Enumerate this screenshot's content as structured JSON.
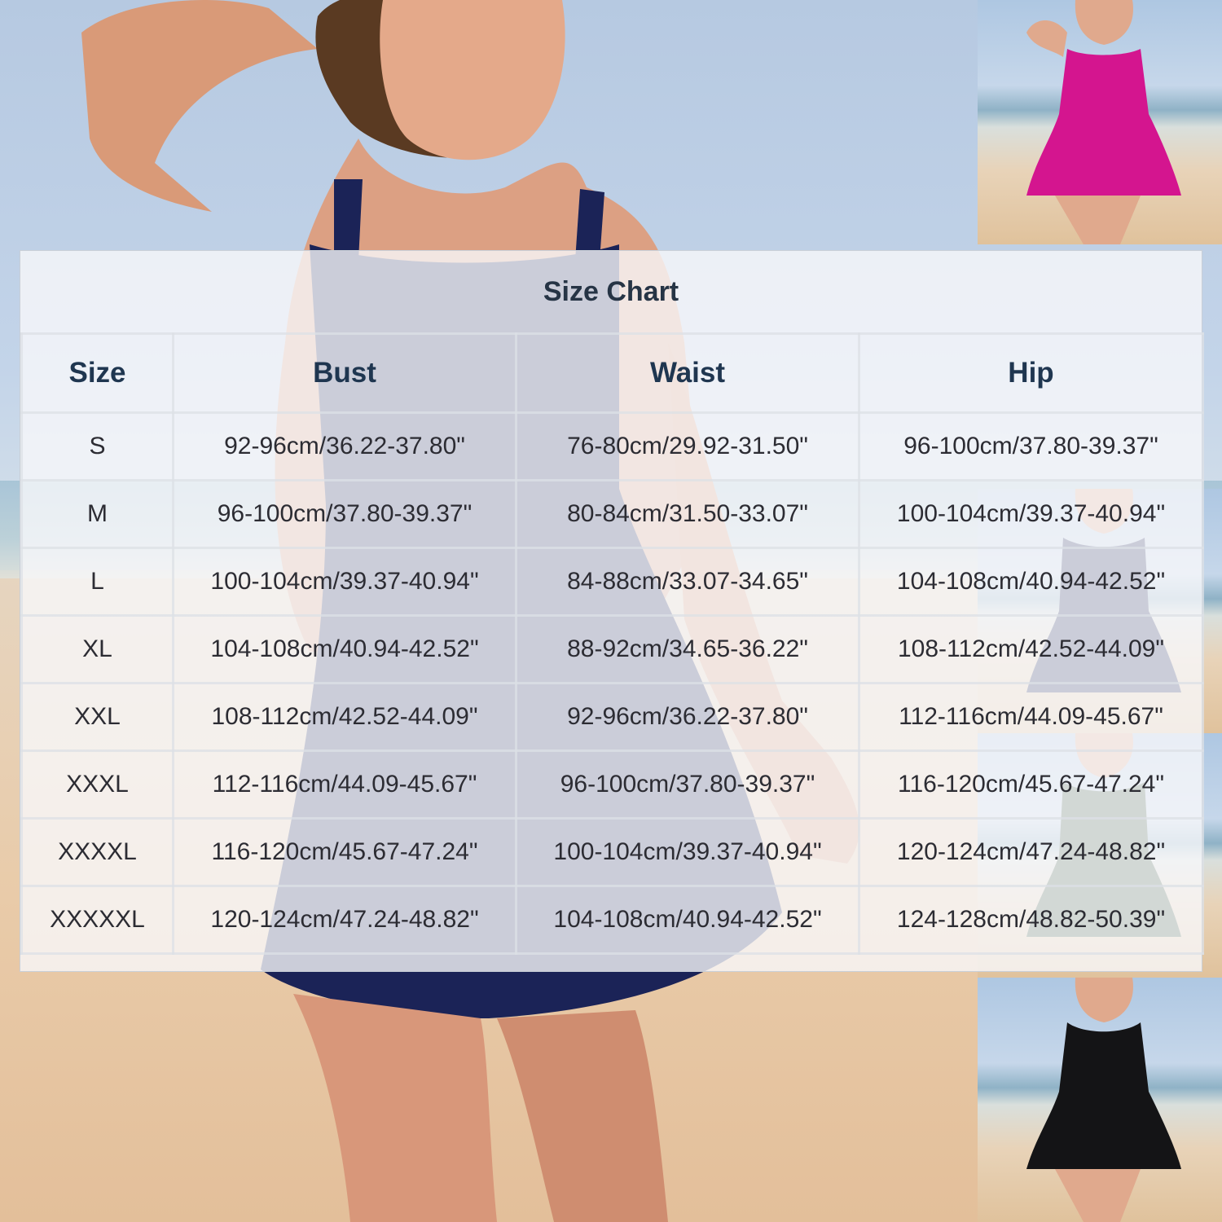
{
  "size_chart": {
    "title": "Size Chart",
    "headers": [
      "Size",
      "Bust",
      "Waist",
      "Hip"
    ],
    "rows": [
      [
        "S",
        "92-96cm/36.22-37.80\"",
        "76-80cm/29.92-31.50\"",
        "96-100cm/37.80-39.37\""
      ],
      [
        "M",
        "96-100cm/37.80-39.37\"",
        "80-84cm/31.50-33.07\"",
        "100-104cm/39.37-40.94\""
      ],
      [
        "L",
        "100-104cm/39.37-40.94\"",
        "84-88cm/33.07-34.65\"",
        "104-108cm/40.94-42.52\""
      ],
      [
        "XL",
        "104-108cm/40.94-42.52\"",
        "88-92cm/34.65-36.22\"",
        "108-112cm/42.52-44.09\""
      ],
      [
        "XXL",
        "108-112cm/42.52-44.09\"",
        "92-96cm/36.22-37.80\"",
        "112-116cm/44.09-45.67\""
      ],
      [
        "XXXL",
        "112-116cm/44.09-45.67\"",
        "96-100cm/37.80-39.37\"",
        "116-120cm/45.67-47.24\""
      ],
      [
        "XXXXL",
        "116-120cm/45.67-47.24\"",
        "100-104cm/39.37-40.94\"",
        "120-124cm/47.24-48.82\""
      ],
      [
        "XXXXXL",
        "120-124cm/47.24-48.82\"",
        "104-108cm/40.94-42.52\"",
        "124-128cm/48.82-50.39\""
      ]
    ]
  },
  "colors": {
    "main_swimsuit": "#1b2357",
    "variant_pink": "#d4158f",
    "variant_black": "#141416",
    "title_text": "#263445",
    "header_text": "#1f3650"
  }
}
